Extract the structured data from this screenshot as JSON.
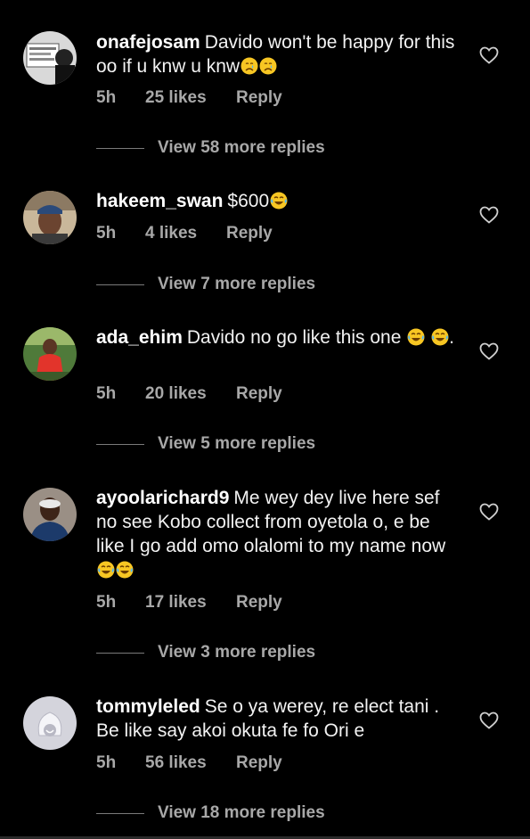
{
  "comments": [
    {
      "username": "onafejosam",
      "text": "Davido won't be happy for this oo if u knw u knw",
      "emojis": [
        "crying-face",
        "crying-face"
      ],
      "time": "5h",
      "likes": "25 likes",
      "reply": "Reply",
      "view_replies": "View 58 more replies"
    },
    {
      "username": "hakeem_swan",
      "text": "$600",
      "emojis": [
        "tears-of-joy"
      ],
      "time": "5h",
      "likes": "4 likes",
      "reply": "Reply",
      "view_replies": "View 7 more replies"
    },
    {
      "username": "ada_ehim",
      "text": "Davido no go like this one",
      "emojis": [
        "tears-of-joy",
        "tears-of-joy"
      ],
      "text_suffix": ".",
      "time": "5h",
      "likes": "20 likes",
      "reply": "Reply",
      "view_replies": "View 5 more replies"
    },
    {
      "username": "ayoolarichard9",
      "text": "Me wey dey live here sef no see Kobo collect from oyetola o, e be like I go add omo olalomi to my name now",
      "emojis": [
        "tears-of-joy",
        "tears-of-joy"
      ],
      "time": "5h",
      "likes": "17 likes",
      "reply": "Reply",
      "view_replies": "View 3 more replies"
    },
    {
      "username": "tommyleled",
      "text": "Se o ya werey, re elect tani . Be like say akoi okuta fe fo Ori e",
      "emojis": [],
      "time": "5h",
      "likes": "56 likes",
      "reply": "Reply",
      "view_replies": "View 18 more replies"
    }
  ],
  "icons": {
    "like": "heart-outline-icon",
    "avatar_placeholder": "default-avatar-icon"
  },
  "colors": {
    "background": "#000000",
    "text": "#f2f2f2",
    "muted": "#a8a8a8"
  }
}
